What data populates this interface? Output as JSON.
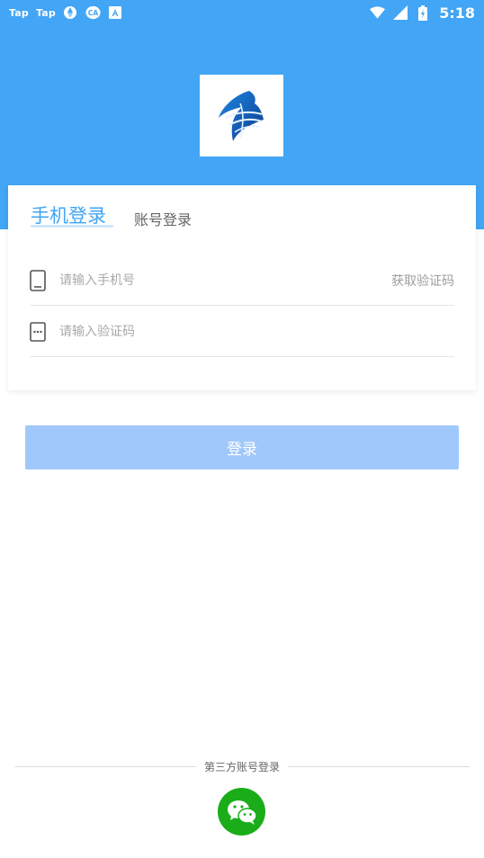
{
  "status_bar": {
    "left_items": [
      "Tap",
      "Tap"
    ],
    "icons_left": [
      "aperture-icon",
      "ca-icon",
      "a-box-icon"
    ],
    "icons_right": [
      "wifi-icon",
      "signal-icon",
      "battery-icon"
    ],
    "time": "5:18"
  },
  "tabs": {
    "phone_login": "手机登录",
    "account_login": "账号登录"
  },
  "form": {
    "phone_placeholder": "请输入手机号",
    "get_code_label": "获取验证码",
    "code_placeholder": "请输入验证码"
  },
  "login_button": {
    "label": "登录"
  },
  "third_party": {
    "label": "第三方账号登录"
  },
  "colors": {
    "header": "#42a5f5",
    "button": "#a0c8fa",
    "wechat": "#1aad19"
  }
}
